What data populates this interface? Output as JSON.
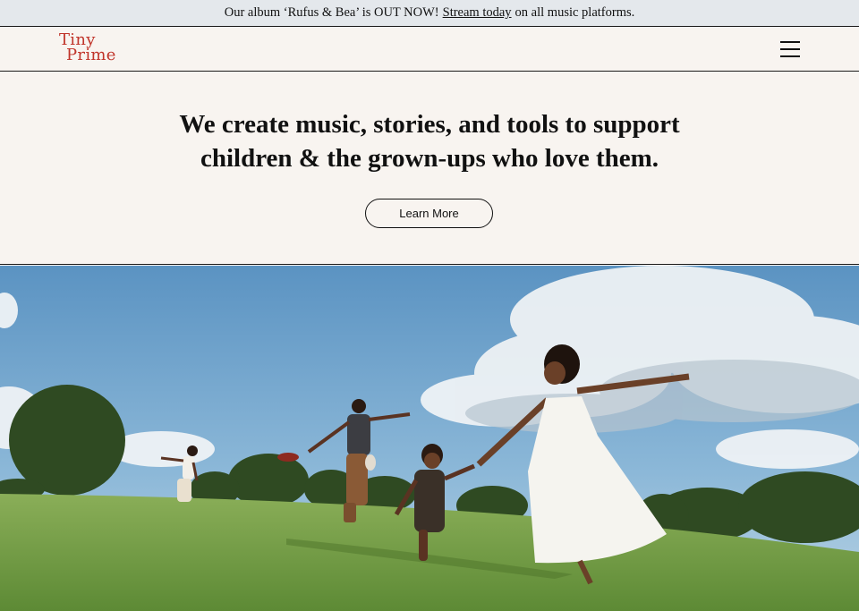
{
  "announcement": {
    "before": "Our album ‘Rufus & Bea’ is OUT NOW!",
    "link": "Stream today",
    "after": "on all music platforms."
  },
  "brand": {
    "line1": "Tiny",
    "line2": "Prime",
    "color": "#c0342a"
  },
  "nav": {
    "menu_icon": "hamburger-menu-icon"
  },
  "hero": {
    "t1": "We create ",
    "b1": "music",
    "t2": ", ",
    "b2": "stories",
    "t3": ", ",
    "b3": "and tools",
    "t4": " to support",
    "line2": "children & the grown-ups who love them.",
    "cta": "Learn More"
  },
  "photo": {
    "subject": "family dancing in a grassy field"
  },
  "colors": {
    "background": "#f8f4f0",
    "announcement_bg": "#e4e8ec",
    "text": "#111111"
  }
}
